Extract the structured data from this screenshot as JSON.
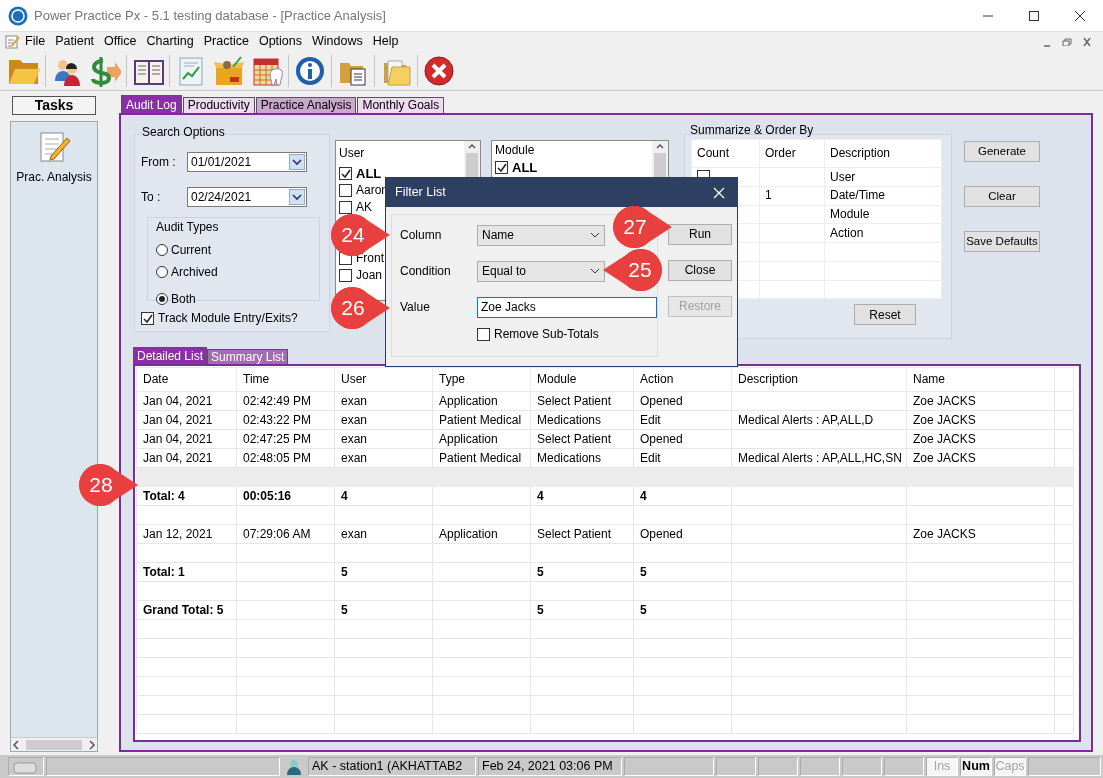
{
  "window": {
    "title": "Power Practice Px - 5.1 testing database - [Practice Analysis]"
  },
  "menu": [
    "File",
    "Patient",
    "Office",
    "Charting",
    "Practice",
    "Options",
    "Windows",
    "Help"
  ],
  "tasks": {
    "title": "Tasks",
    "items": [
      {
        "label": "Prac. Analysis"
      }
    ]
  },
  "tabs": [
    {
      "label": "Audit Log",
      "selected": true,
      "color": "#8b2fa8"
    },
    {
      "label": "Productivity",
      "selected": false,
      "color": "#efdaf1"
    },
    {
      "label": "Practice Analysis",
      "selected": false,
      "color": "#cba6d0"
    },
    {
      "label": "Monthly Goals",
      "selected": false,
      "color": "#efdaf1"
    }
  ],
  "search_options": {
    "title": "Search Options",
    "from": {
      "label": "From :",
      "value": "01/01/2021"
    },
    "to": {
      "label": "To :",
      "value": "02/24/2021"
    },
    "audit_types": {
      "title": "Audit Types",
      "options": [
        {
          "label": "Current",
          "selected": false
        },
        {
          "label": "Archived",
          "selected": false
        },
        {
          "label": "Both",
          "selected": true
        }
      ]
    },
    "track": {
      "label": "Track Module Entry/Exits?",
      "checked": true
    }
  },
  "user_list": {
    "title": "User",
    "items_top": [
      {
        "label": "ALL",
        "checked": true
      },
      {
        "label": "Aaron",
        "checked": false
      },
      {
        "label": "AK",
        "checked": false
      }
    ],
    "items_bottom": [
      {
        "label": "Front",
        "checked": false
      },
      {
        "label": "Joan",
        "checked": false
      }
    ]
  },
  "module_list": {
    "title": "Module",
    "items": [
      {
        "label": "ALL",
        "checked": true
      }
    ]
  },
  "summarize": {
    "title": "Summarize & Order By",
    "columns": [
      "Count",
      "Order",
      "Description"
    ],
    "rows": [
      {
        "count_checked": false,
        "description": "User"
      },
      {
        "order": "1",
        "description": "Date/Time"
      },
      {
        "description": "Module"
      },
      {
        "description": "Action"
      }
    ],
    "reset": "Reset"
  },
  "buttons": [
    "Generate",
    "Clear",
    "Save Defaults"
  ],
  "list_tabs": [
    {
      "label": "Detailed List",
      "selected": true
    },
    {
      "label": "Summary List",
      "selected": false
    }
  ],
  "table": {
    "columns": [
      "Date",
      "Time",
      "User",
      "Type",
      "Module",
      "Action",
      "Description",
      "Name"
    ],
    "rows": [
      {
        "kind": "data",
        "cells": [
          "Jan 04, 2021",
          "02:42:49 PM",
          "exan",
          "Application",
          "Select Patient",
          "Opened",
          null,
          "Zoe JACKS"
        ]
      },
      {
        "kind": "data",
        "cells": [
          "Jan 04, 2021",
          "02:43:22 PM",
          "exan",
          "Patient Medical",
          "Medications",
          "Edit",
          "Medical Alerts : AP,ALL,D",
          "Zoe JACKS"
        ]
      },
      {
        "kind": "data",
        "cells": [
          "Jan 04, 2021",
          "02:47:25 PM",
          "exan",
          "Application",
          "Select Patient",
          "Opened",
          null,
          "Zoe JACKS"
        ]
      },
      {
        "kind": "data",
        "cells": [
          "Jan 04, 2021",
          "02:48:05 PM",
          "exan",
          "Patient Medical",
          "Medications",
          "Edit",
          "Medical Alerts : AP,ALL,HC,SN",
          "Zoe JACKS"
        ]
      },
      {
        "kind": "highlight"
      },
      {
        "kind": "total",
        "cells": [
          "Total: 4",
          "00:05:16",
          "4",
          null,
          "4",
          "4",
          null,
          null
        ]
      },
      {
        "kind": "blank"
      },
      {
        "kind": "data",
        "cells": [
          "Jan 12, 2021",
          "07:29:06 AM",
          "exan",
          "Application",
          "Select Patient",
          "Opened",
          null,
          "Zoe JACKS"
        ]
      },
      {
        "kind": "blank"
      },
      {
        "kind": "total",
        "cells": [
          "Total: 1",
          null,
          "5",
          null,
          "5",
          "5",
          null,
          null
        ]
      },
      {
        "kind": "blank"
      },
      {
        "kind": "total",
        "cells": [
          "Grand Total: 5",
          null,
          "5",
          null,
          "5",
          "5",
          null,
          null
        ]
      }
    ]
  },
  "dialog": {
    "title": "Filter List",
    "fields": [
      {
        "label": "Column",
        "kind": "select",
        "value": "Name"
      },
      {
        "label": "Condition",
        "kind": "select",
        "value": "Equal to"
      },
      {
        "label": "Value",
        "kind": "text",
        "value": "Zoe Jacks"
      }
    ],
    "remove_subtotals": {
      "label": "Remove Sub-Totals",
      "checked": false
    },
    "buttons": [
      {
        "label": "Run",
        "disabled": false
      },
      {
        "label": "Close",
        "disabled": false
      },
      {
        "label": "Restore",
        "disabled": true
      }
    ]
  },
  "callouts": [
    {
      "number": "24"
    },
    {
      "number": "25"
    },
    {
      "number": "26"
    },
    {
      "number": "27"
    },
    {
      "number": "28"
    }
  ],
  "status_bar": {
    "station": "AK - station1 (AKHATTAB2",
    "datetime": "Feb 24, 2021 03:06 PM",
    "keys": [
      {
        "label": "Ins",
        "on": false
      },
      {
        "label": "Num",
        "on": true
      },
      {
        "label": "Caps",
        "on": false
      }
    ]
  }
}
